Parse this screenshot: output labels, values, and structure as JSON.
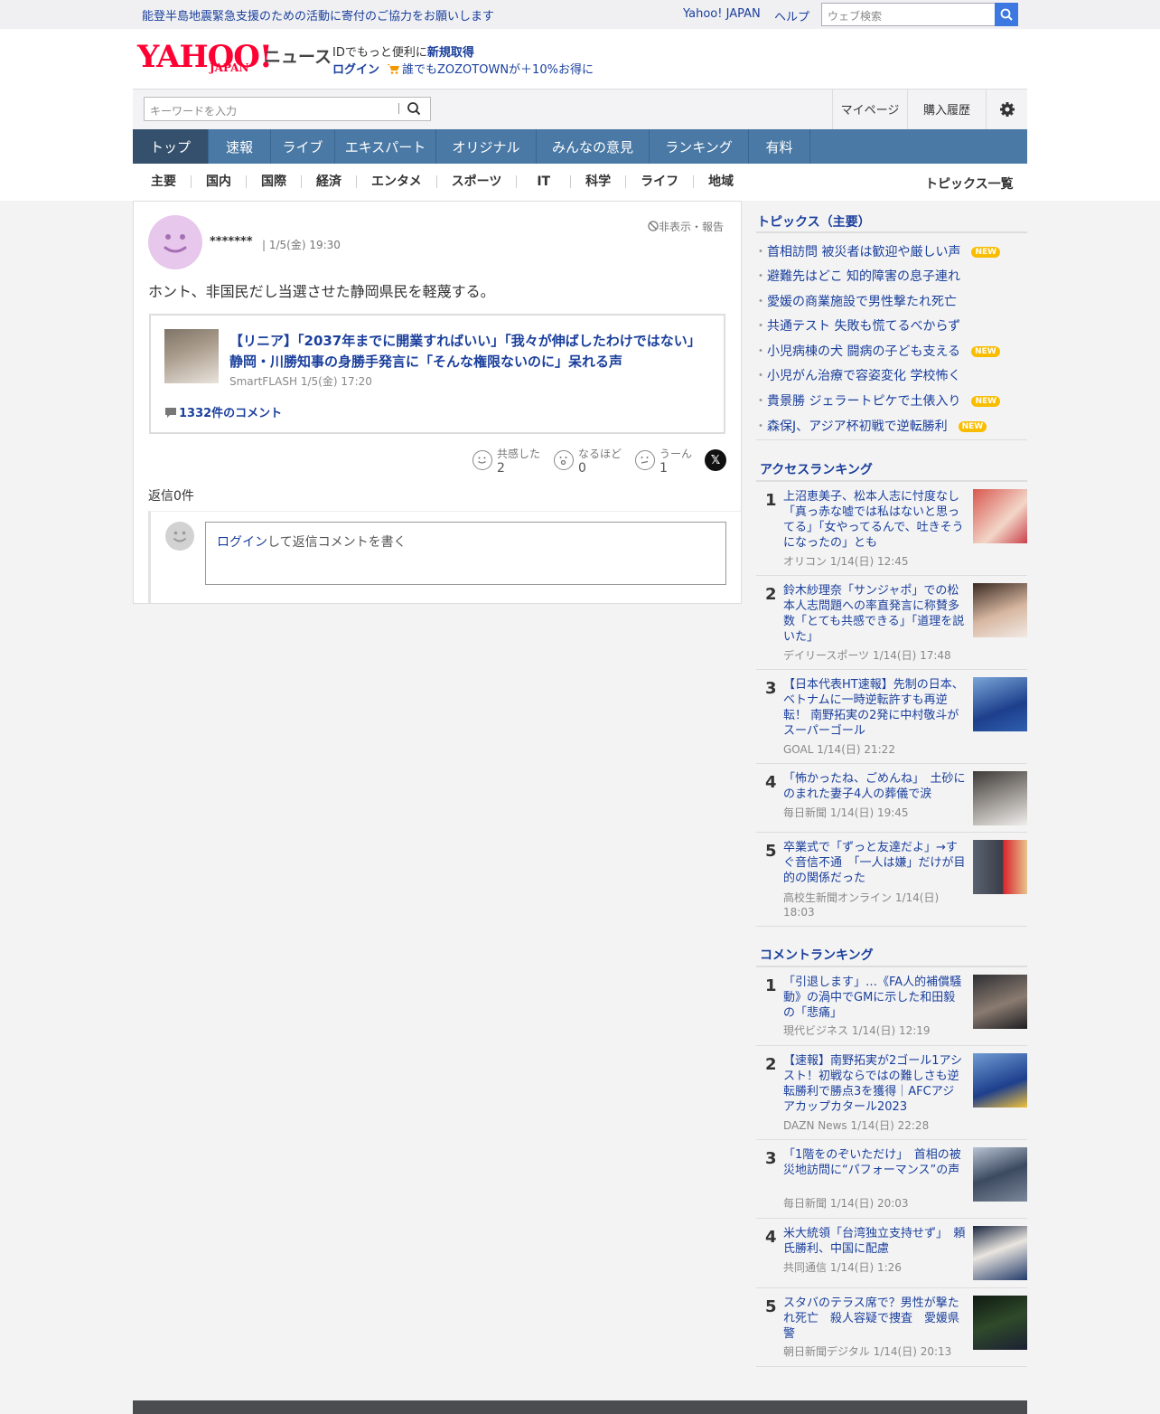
{
  "topbar": {
    "donation": "能登半島地震緊急支援のための活動に寄付のご協力をお願いします",
    "yahoo_japan": "Yahoo! JAPAN",
    "help": "ヘルプ",
    "search_placeholder": "ウェブ検索"
  },
  "header": {
    "logo": "YAHOO!",
    "logo_sub": "JAPAN",
    "news": "ニュース",
    "promo_text": "IDでもっと便利に",
    "promo_link": "新規取得",
    "login": "ログイン",
    "zozo": "誰でもZOZOTOWNが＋10%お得に"
  },
  "toolbar": {
    "keyword_placeholder": "キーワードを入力",
    "mypage": "マイページ",
    "history": "購入履歴"
  },
  "nav": [
    "トップ",
    "速報",
    "ライブ",
    "エキスパート",
    "オリジナル",
    "みんなの意見",
    "ランキング",
    "有料"
  ],
  "subnav": [
    "主要",
    "国内",
    "国際",
    "経済",
    "エンタメ",
    "スポーツ",
    "IT",
    "科学",
    "ライフ",
    "地域"
  ],
  "topics_all": "トピックス一覧",
  "comment": {
    "user": "*******",
    "date": "| 1/5(金) 19:30",
    "report": "非表示・報告",
    "text": "ホント、非国民だし当選させた静岡県民を軽蔑する。",
    "article": {
      "title": "【リニア】「2037年までに開業すればいい」「我々が伸ばしたわけではない」 静岡・川勝知事の身勝手発言に「そんな権限ないのに」呆れる声",
      "source": "SmartFLASH 1/5(金) 17:20",
      "comments": "1332件のコメント"
    },
    "reactions": [
      {
        "label": "共感した",
        "count": "2"
      },
      {
        "label": "なるほど",
        "count": "0"
      },
      {
        "label": "うーん",
        "count": "1"
      }
    ],
    "x_label": "𝕏",
    "replies": "返信0件",
    "reply_login": "ログイン",
    "reply_text": "して返信コメントを書く"
  },
  "topics": {
    "heading": "トピックス（主要）",
    "new_label": "NEW",
    "items": [
      {
        "text": "首相訪問 被災者は歓迎や厳しい声",
        "new": true
      },
      {
        "text": "避難先はどこ 知的障害の息子連れ",
        "new": false
      },
      {
        "text": "愛媛の商業施設で男性撃たれ死亡",
        "new": false
      },
      {
        "text": "共通テスト 失敗も慌てるべからず",
        "new": false
      },
      {
        "text": "小児病棟の犬 闘病の子ども支える",
        "new": true
      },
      {
        "text": "小児がん治療で容姿変化 学校怖く",
        "new": false
      },
      {
        "text": "貴景勝 ジェラートピケで土俵入り",
        "new": true
      },
      {
        "text": "森保J、アジア杯初戦で逆転勝利",
        "new": true
      }
    ]
  },
  "access_ranking": {
    "heading": "アクセスランキング",
    "items": [
      {
        "no": "1",
        "title": "上沼恵美子、松本人志に忖度なし「真っ赤な嘘では私はないと思ってる」「女やってるんで、吐きそうになったの」とも",
        "source": "オリコン 1/14(日) 12:45"
      },
      {
        "no": "2",
        "title": "鈴木紗理奈「サンジャポ」での松本人志問題への率直発言に称賛多数「とても共感できる」「道理を説いた」",
        "source": "デイリースポーツ 1/14(日) 17:48"
      },
      {
        "no": "3",
        "title": "【日本代表HT速報】先制の日本、ベトナムに一時逆転許すも再逆転！ 南野拓実の2発に中村敬斗がスーパーゴール",
        "source": "GOAL 1/14(日) 21:22"
      },
      {
        "no": "4",
        "title": "「怖かったね、ごめんね」　土砂にのまれた妻子4人の葬儀で涙",
        "source": "毎日新聞 1/14(日) 19:45"
      },
      {
        "no": "5",
        "title": "卒業式で「ずっと友達だよ」→すぐ音信不通　「一人は嫌」だけが目的の関係だった",
        "source": "高校生新聞オンライン 1/14(日) 18:03"
      }
    ]
  },
  "comment_ranking": {
    "heading": "コメントランキング",
    "items": [
      {
        "no": "1",
        "title": "「引退します」…《FA人的補償騒動》の渦中でGMに示した和田毅の「悲痛」",
        "source": "現代ビジネス 1/14(日) 12:19"
      },
      {
        "no": "2",
        "title": "【速報】南野拓実が2ゴール1アシスト！初戦ならではの難しさも逆転勝利で勝点3を獲得｜AFCアジアカップカタール2023",
        "source": "DAZN News 1/14(日) 22:28"
      },
      {
        "no": "3",
        "title": "「1階をのぞいただけ」　首相の被災地訪問に“パフォーマンス”の声",
        "source": "毎日新聞 1/14(日) 20:03"
      },
      {
        "no": "4",
        "title": "米大統領「台湾独立支持せず」　頼氏勝利、中国に配慮",
        "source": "共同通信 1/14(日) 1:26"
      },
      {
        "no": "5",
        "title": "スタバのテラス席で？男性が撃たれ死亡　殺人容疑で捜査　愛媛県警",
        "source": "朝日新聞デジタル 1/14(日) 20:13"
      }
    ]
  }
}
